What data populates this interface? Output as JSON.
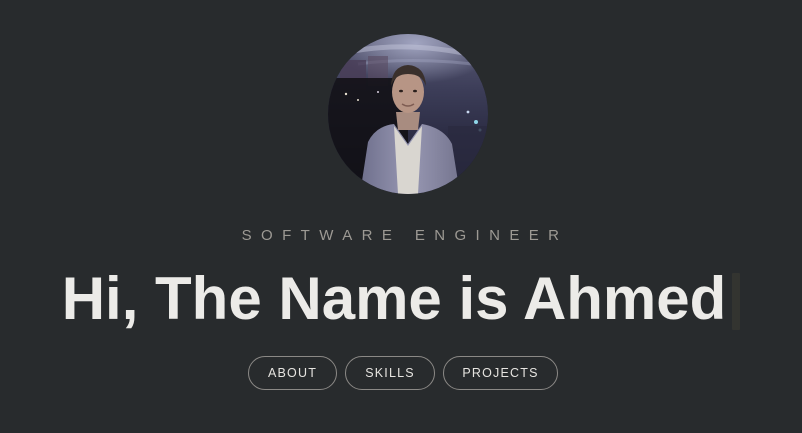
{
  "profile": {
    "role": "SOFTWARE ENGINEER",
    "headline": "Hi, The Name is Ahmed"
  },
  "nav": {
    "about": "ABOUT",
    "skills": "SKILLS",
    "projects": "PROJECTS"
  },
  "colors": {
    "background": "#282b2d",
    "headline": "#ecebe8",
    "role": "#9d9a94",
    "button_border": "#8b8986"
  }
}
